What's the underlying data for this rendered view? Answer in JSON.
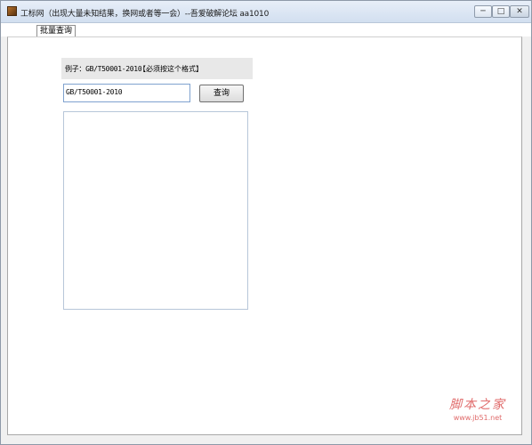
{
  "window": {
    "title": "工标网（出现大量未知结果，换网或者等一会）--吾爱破解论坛 aa1010",
    "minimize_glyph": "─",
    "maximize_glyph": "□",
    "close_glyph": "✕"
  },
  "tabs": [
    {
      "label": "批量查询",
      "active": true
    }
  ],
  "form": {
    "example_label": "例子：GB/T50001-2010",
    "example_note": "【必须按这个格式】",
    "standard_value": "GB/T50001-2010",
    "query_label": "查询",
    "results": ""
  },
  "watermark": {
    "title": "脚本之家",
    "url": "www.jb51.net",
    "color": "#e06b6b"
  },
  "icons": {
    "app": "app-icon",
    "minimize": "minimize-icon",
    "maximize": "maximize-icon",
    "close": "close-icon"
  }
}
